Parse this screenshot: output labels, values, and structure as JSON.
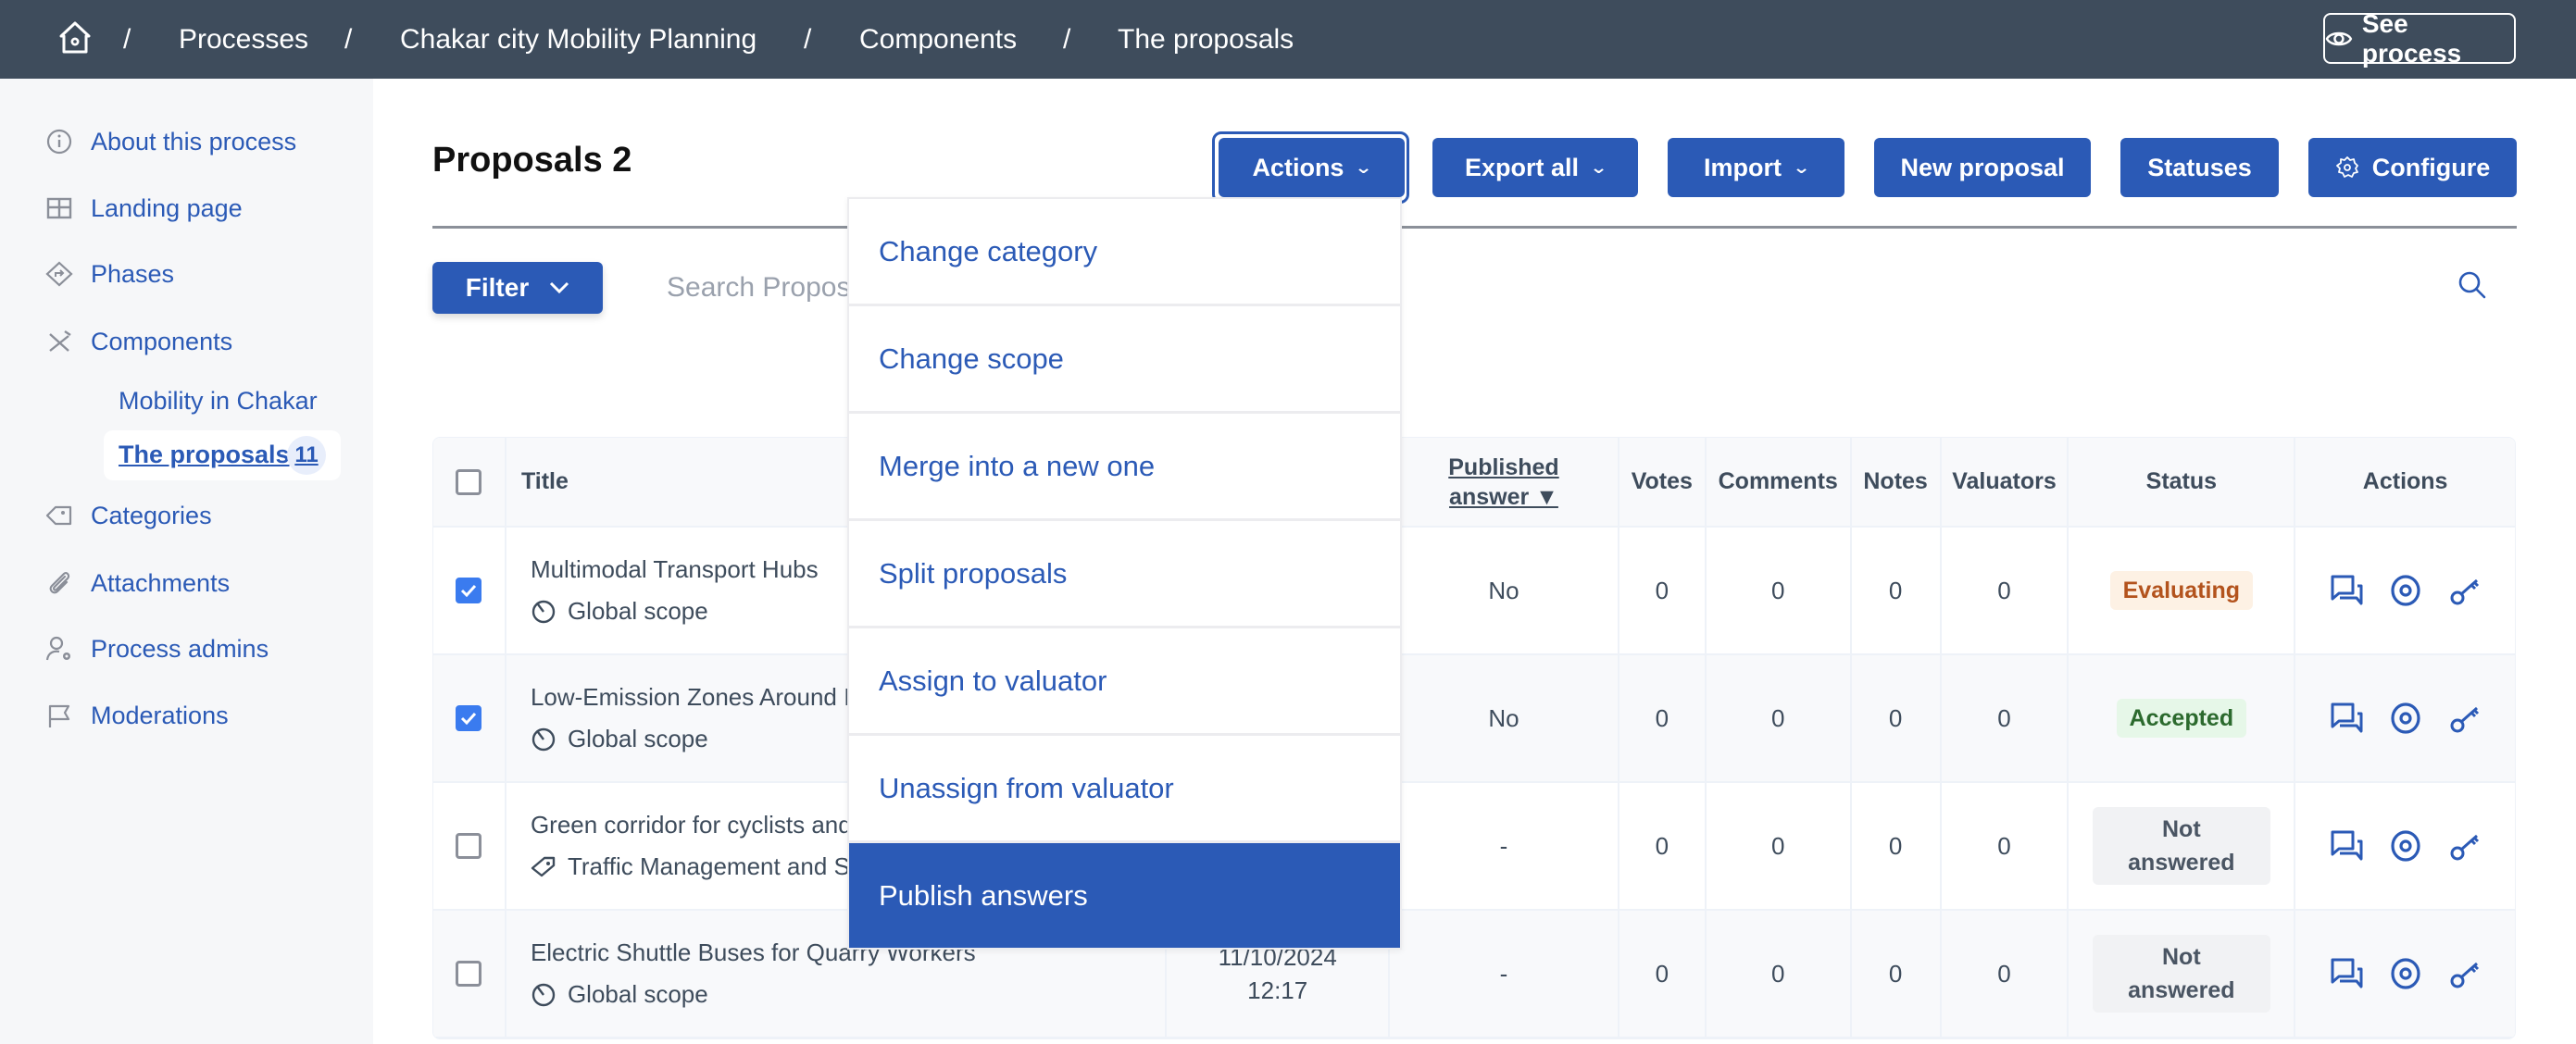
{
  "topbar": {
    "home_icon": "home-gear-icon",
    "breadcrumb": [
      "Processes",
      "Chakar city Mobility Planning",
      "Components",
      "The proposals"
    ],
    "separator": "/",
    "see_process_label": "See process",
    "see_process_icon": "eye-icon"
  },
  "sidebar": {
    "items": [
      {
        "label": "About this process",
        "icon": "info-icon"
      },
      {
        "label": "Landing page",
        "icon": "layout-icon"
      },
      {
        "label": "Phases",
        "icon": "route-diamond-icon"
      },
      {
        "label": "Components",
        "icon": "tools-icon"
      },
      {
        "label": "Categories",
        "icon": "tag-icon"
      },
      {
        "label": "Attachments",
        "icon": "paperclip-icon"
      },
      {
        "label": "Process admins",
        "icon": "user-settings-icon"
      },
      {
        "label": "Moderations",
        "icon": "flag-icon"
      }
    ],
    "sub_items": [
      {
        "label": "Mobility in Chakar"
      },
      {
        "label": "The proposals",
        "count": "11",
        "active": true
      }
    ]
  },
  "header": {
    "title": "Proposals 2",
    "buttons": {
      "actions": "Actions",
      "export_all": "Export all",
      "import": "Import",
      "new_proposal": "New proposal",
      "statuses": "Statuses",
      "configure": "Configure"
    }
  },
  "filter": {
    "label": "Filter",
    "search_placeholder": "Search Proposals"
  },
  "actions_menu": {
    "items": [
      "Change category",
      "Change scope",
      "Merge into a new one",
      "Split proposals",
      "Assign to valuator",
      "Unassign from valuator",
      "Publish answers"
    ],
    "highlighted": "Publish answers"
  },
  "table": {
    "columns": {
      "title": "Title",
      "published_answer_line1": "Published",
      "published_answer_line2": "answer ▼",
      "votes": "Votes",
      "comments": "Comments",
      "notes": "Notes",
      "valuators": "Valuators",
      "status": "Status",
      "actions": "Actions"
    },
    "rows": [
      {
        "checked": true,
        "title": "Multimodal Transport Hubs",
        "meta": "Global scope",
        "meta_icon": "scope-icon",
        "date": "",
        "time": "",
        "published_answer": "No",
        "votes": "0",
        "comments": "0",
        "notes": "0",
        "valuators": "0",
        "status": "Evaluating",
        "status_color": "#b3531d"
      },
      {
        "checked": true,
        "title": "Low-Emission Zones Around I",
        "meta": "Global scope",
        "meta_icon": "scope-icon",
        "date": "",
        "time": "",
        "published_answer": "No",
        "votes": "0",
        "comments": "0",
        "notes": "0",
        "valuators": "0",
        "status": "Accepted",
        "status_color": "#2c6a2e"
      },
      {
        "checked": false,
        "title": "Green corridor for cyclists and",
        "meta": "Traffic Management and S",
        "meta_icon": "tag-icon",
        "date": "",
        "time": "",
        "published_answer": "-",
        "votes": "0",
        "comments": "0",
        "notes": "0",
        "valuators": "0",
        "status_line1": "Not",
        "status_line2": "answered",
        "status_color": "#4a5563"
      },
      {
        "checked": false,
        "title": "Electric Shuttle Buses for Quarry Workers",
        "meta": "Global scope",
        "meta_icon": "scope-icon",
        "date": "11/10/2024",
        "time": "12:17",
        "published_answer": "-",
        "votes": "0",
        "comments": "0",
        "notes": "0",
        "valuators": "0",
        "status_line1": "Not",
        "status_line2": "answered",
        "status_color": "#4a5563"
      }
    ],
    "row_action_icons": [
      "answer-chat-icon",
      "preview-eye-icon",
      "permissions-key-icon"
    ]
  },
  "colors": {
    "topbar": "#3e4c5c",
    "primary": "#2b5ab6",
    "sidebar_bg": "#f6f7f9",
    "checkbox_checked": "#3a7bef"
  }
}
